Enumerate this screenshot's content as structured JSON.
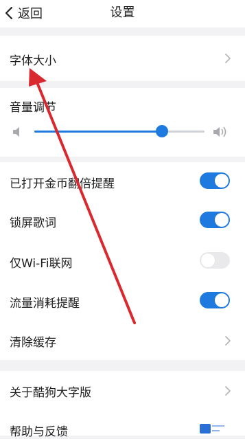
{
  "header": {
    "back_label": "返回",
    "title": "设置"
  },
  "settings": {
    "font_size": {
      "label": "字体大小"
    },
    "volume": {
      "label": "音量调节",
      "level": 0.75,
      "min_icon": "volume-low-icon",
      "max_icon": "volume-high-icon"
    },
    "toggles": [
      {
        "label": "已打开金币翻倍提醒",
        "on": true
      },
      {
        "label": "锁屏歌词",
        "on": true
      },
      {
        "label": "仅Wi-Fi联网",
        "on": false
      },
      {
        "label": "流量消耗提醒",
        "on": true
      }
    ],
    "clear_cache": {
      "label": "清除缓存"
    },
    "about": {
      "label": "关于酷狗大字版"
    },
    "help": {
      "label": "帮助与反馈"
    }
  },
  "colors": {
    "accent": "#1f7ae0",
    "toggle_off": "#e9e9ec",
    "annotation_arrow": "#d9282e",
    "background": "#f2f2f4"
  },
  "annotation": {
    "type": "arrow",
    "points_to": "字体大小"
  },
  "watermark": {
    "icon": "site-logo-icon"
  }
}
